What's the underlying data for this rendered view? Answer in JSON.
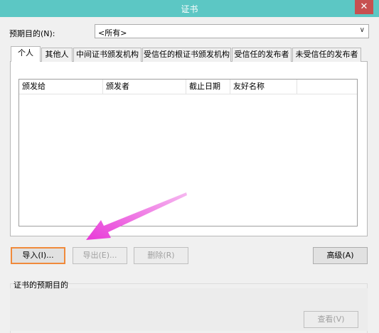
{
  "window": {
    "title": "证书",
    "close_glyph": "✕"
  },
  "purpose": {
    "label": "预期目的(N):",
    "selected": "<所有>"
  },
  "tabs": [
    {
      "label": "个人",
      "active": true
    },
    {
      "label": "其他人"
    },
    {
      "label": "中间证书颁发机构"
    },
    {
      "label": "受信任的根证书颁发机构"
    },
    {
      "label": "受信任的发布者"
    },
    {
      "label": "未受信任的发布者"
    }
  ],
  "columns": [
    "颁发给",
    "颁发者",
    "截止日期",
    "友好名称"
  ],
  "buttons": {
    "import": "导入(I)...",
    "export": "导出(E)...",
    "remove": "删除(R)",
    "advanced": "高级(A)",
    "view": "查看(V)"
  },
  "purpose_group": {
    "label": "证书的预期目的"
  },
  "colors": {
    "titlebar": "#5cc7c4",
    "arrow": "#e83ad8",
    "focus": "#f08a3b"
  },
  "icons": {
    "close": "close-icon",
    "dropdown": "chevron-down-icon",
    "annotation": "annotation-arrow-icon"
  }
}
